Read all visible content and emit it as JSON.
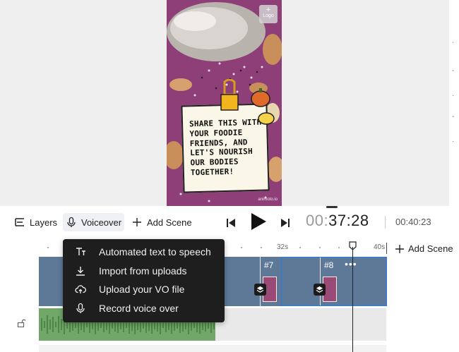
{
  "preview": {
    "logo_label": "Logo",
    "note_text": "SHARE THIS WITH YOUR FOODIE FRIENDS, AND LET'S NOURISH OUR BODIES TOGETHER!",
    "watermark": "animoto.io"
  },
  "toolbar": {
    "layers_label": "Layers",
    "voiceover_label": "Voiceover",
    "add_scene_label": "Add Scene",
    "time_current_prefix": "00:",
    "time_current_main": "37:28",
    "time_total": "00:40:23"
  },
  "timeline": {
    "ruler_labels": [
      "32s",
      "40s"
    ],
    "add_scene_label": "Add Scene",
    "scenes": [
      {
        "label": "#7"
      },
      {
        "label": "#8",
        "more": "•••"
      }
    ]
  },
  "voiceover_menu": {
    "items": [
      {
        "label": "Automated text to speech",
        "icon": "text-to-speech-icon"
      },
      {
        "label": "Import from uploads",
        "icon": "download-icon"
      },
      {
        "label": "Upload your VO file",
        "icon": "cloud-upload-icon"
      },
      {
        "label": "Record voice over",
        "icon": "microphone-icon"
      }
    ]
  },
  "colors": {
    "accent": "#2a7ae4",
    "track": "#5e7898",
    "waveform": "#71a86a",
    "menu_bg": "#1e1e1e"
  }
}
